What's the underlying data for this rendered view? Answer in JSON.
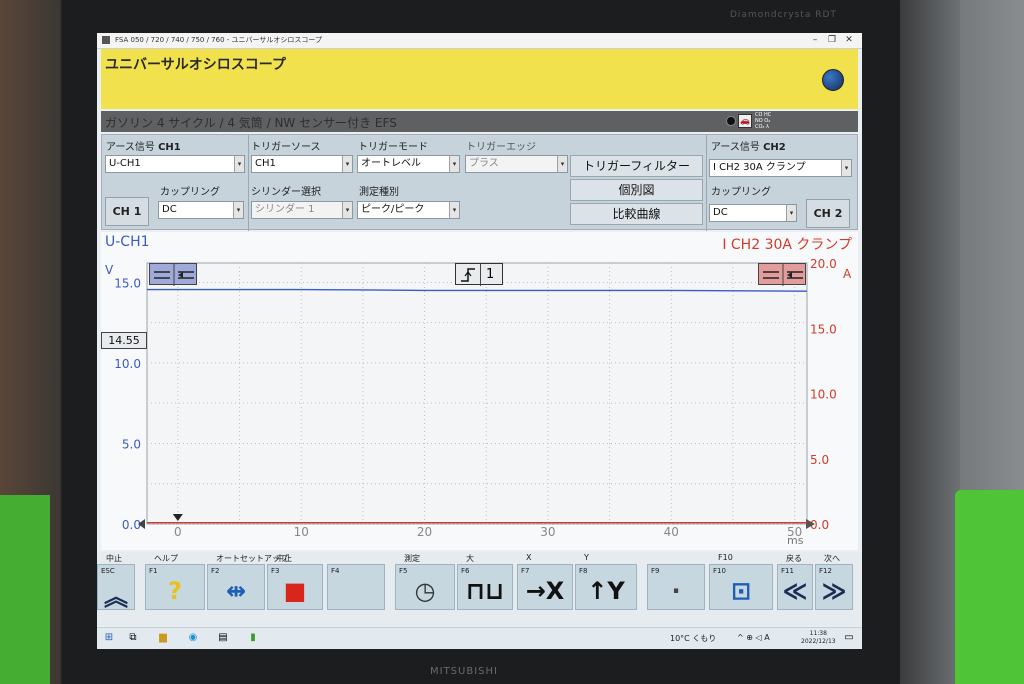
{
  "monitor": {
    "brand": "Diamondcrysta RDT",
    "maker": "MITSUBISHI"
  },
  "window": {
    "title": "FSA 050 / 720 / 740 / 750 / 760 - ユニバーサルオシロスコープ"
  },
  "app": {
    "title": "ユニバーサルオシロスコープ"
  },
  "vehicle": {
    "description": "ガソリン 4 サイクル / 4 気筒 / NW センサー付き EFS",
    "gas_labels": [
      "CO HC",
      "NO O₂",
      "CO₂ λ"
    ]
  },
  "controls": {
    "ch1_source_label": "アース信号",
    "ch1_source_bold": "CH1",
    "ch1_source_value": "U-CH1",
    "coupling_label": "カップリング",
    "ch1_coupling_value": "DC",
    "ch1_button": "CH 1",
    "trigger_source_label": "トリガーソース",
    "trigger_source_value": "CH1",
    "trigger_mode_label": "トリガーモード",
    "trigger_mode_value": "オートレベル",
    "trigger_edge_label": "トリガーエッジ",
    "trigger_edge_value": "プラス",
    "cylinder_label": "シリンダー選択",
    "cylinder_value": "シリンダー 1",
    "measure_label": "測定種別",
    "measure_value": "ピーク/ピーク",
    "trigger_filter_button": "トリガーフィルター",
    "individual_button": "個別図",
    "compare_button": "比較曲線",
    "ch2_source_label": "アース信号",
    "ch2_source_bold": "CH2",
    "ch2_source_value": "I CH2 30A クランプ",
    "ch2_coupling_value": "DC",
    "ch2_button": "CH 2"
  },
  "scope": {
    "ch1_name": "U-CH1",
    "ch2_name": "I CH2 30A クランプ",
    "left_unit": "V",
    "right_unit": "A",
    "x_unit": "ms",
    "cursor_value": "14.55",
    "trigger_channel": "1",
    "colors": {
      "ch1": "#3a5ac6",
      "ch2": "#d43a2a"
    }
  },
  "chart_data": {
    "type": "line",
    "title": "",
    "xlabel": "ms",
    "ylabel": "V",
    "y2label": "A",
    "xlim": [
      -2.5,
      51
    ],
    "ylim": [
      0,
      16.2
    ],
    "y2lim": [
      0,
      20
    ],
    "x_ticks": [
      "0",
      "10",
      "20",
      "30",
      "40",
      "50"
    ],
    "x_tick_values": [
      0,
      10,
      20,
      30,
      40,
      50
    ],
    "y_ticks": [
      "0.0",
      "5.0",
      "10.0",
      "15.0"
    ],
    "y_tick_values": [
      0,
      5,
      10,
      15
    ],
    "y2_ticks": [
      "0.0",
      "5.0",
      "10.0",
      "15.0",
      "20.0"
    ],
    "y2_tick_values": [
      0,
      5,
      10,
      15,
      20
    ],
    "grid": true,
    "series": [
      {
        "name": "U-CH1",
        "axis": "left",
        "color": "#3a5ac6",
        "x": [
          -2.5,
          10,
          20,
          30,
          40,
          51
        ],
        "values": [
          14.55,
          14.55,
          14.5,
          14.5,
          14.5,
          14.45
        ]
      },
      {
        "name": "I CH2 30A クランプ",
        "axis": "right",
        "color": "#d43a2a",
        "x": [
          -2.5,
          10,
          20,
          30,
          40,
          51
        ],
        "values": [
          0.1,
          0.1,
          0.1,
          0.1,
          0.1,
          0.1
        ]
      }
    ]
  },
  "fkeys": [
    {
      "top": "中止",
      "key": "ESC",
      "glyph": "︽",
      "color": "#1a2e55"
    },
    {
      "top": "ヘルプ",
      "key": "F1",
      "glyph": "?",
      "color": "#e8c21a"
    },
    {
      "top": "オートセットアップ",
      "key": "F2",
      "glyph": "⇹",
      "color": "#1d5fb8"
    },
    {
      "top": "中止",
      "key": "F3",
      "glyph": "■",
      "color": "#d8261c"
    },
    {
      "top": "",
      "key": "F4",
      "glyph": "",
      "color": "#888"
    },
    {
      "top": "測定",
      "key": "F5",
      "glyph": "◷",
      "color": "#333"
    },
    {
      "top": "大",
      "key": "F6",
      "glyph": "⊓⊔",
      "color": "#111"
    },
    {
      "top": "X",
      "key": "F7",
      "glyph": "→X",
      "color": "#111"
    },
    {
      "top": "Y",
      "key": "F8",
      "glyph": "↑Y",
      "color": "#111"
    },
    {
      "top": "",
      "key": "F9",
      "glyph": "·",
      "color": "#444"
    },
    {
      "top": "F10",
      "key": "F10",
      "glyph": "⊡",
      "color": "#1d5fb8"
    },
    {
      "top": "戻る",
      "key": "F11",
      "glyph": "≪",
      "color": "#1a2e55"
    },
    {
      "top": "次へ",
      "key": "F12",
      "glyph": "≫",
      "color": "#1a2e55"
    }
  ],
  "taskbar": {
    "weather": "10°C くもり",
    "sys": "^ ⊕ ◁ A",
    "time": "11:38",
    "date": "2022/12/13"
  }
}
